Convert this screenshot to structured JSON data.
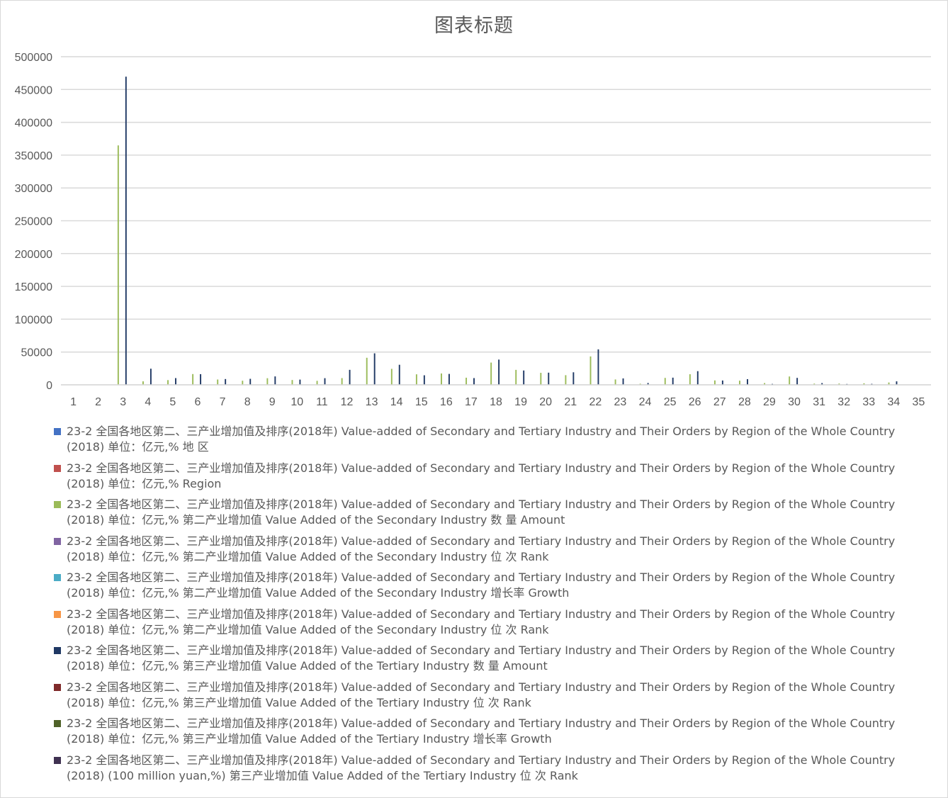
{
  "chart_data": {
    "type": "bar",
    "title": "图表标题",
    "xlabel": "",
    "ylabel": "",
    "ylim": [
      0,
      500000
    ],
    "yticks": [
      "0",
      "50000",
      "100000",
      "150000",
      "200000",
      "250000",
      "300000",
      "350000",
      "400000",
      "450000",
      "500000"
    ],
    "grid": true,
    "legend_position": "bottom",
    "categories": [
      "1",
      "2",
      "3",
      "4",
      "5",
      "6",
      "7",
      "8",
      "9",
      "10",
      "11",
      "12",
      "13",
      "14",
      "15",
      "16",
      "17",
      "18",
      "19",
      "20",
      "21",
      "22",
      "23",
      "24",
      "25",
      "26",
      "27",
      "28",
      "29",
      "30",
      "31",
      "32",
      "33",
      "34",
      "35"
    ],
    "series": [
      {
        "name": "23-2 全国各地区第二、三产业增加值及排序(2018年) Value-added of Secondary and Tertiary Industry and Their Orders by Region of the Whole Country (2018) 单位：亿元,% 地 区",
        "color": "#4472c4",
        "values": [
          0,
          0,
          0,
          0,
          0,
          0,
          0,
          0,
          0,
          0,
          0,
          0,
          0,
          0,
          0,
          0,
          0,
          0,
          0,
          0,
          0,
          0,
          0,
          0,
          0,
          0,
          0,
          0,
          0,
          0,
          0,
          0,
          0,
          0,
          0
        ]
      },
      {
        "name": "23-2 全国各地区第二、三产业增加值及排序(2018年) Value-added of Secondary and Tertiary Industry and Their Orders by Region of the Whole Country (2018) 单位：亿元,% Region",
        "color": "#c0504d",
        "values": [
          0,
          0,
          0,
          0,
          0,
          0,
          0,
          0,
          0,
          0,
          0,
          0,
          0,
          0,
          0,
          0,
          0,
          0,
          0,
          0,
          0,
          0,
          0,
          0,
          0,
          0,
          0,
          0,
          0,
          0,
          0,
          0,
          0,
          0,
          0
        ]
      },
      {
        "name": "23-2 全国各地区第二、三产业增加值及排序(2018年) Value-added of Secondary and Tertiary Industry and Their Orders by Region of the Whole Country (2018) 单位：亿元,% 第二产业增加值 Value Added of the Secondary Industry 数 量 Amount",
        "color": "#9bbb59",
        "values": [
          0,
          0,
          364835,
          5328,
          7194,
          16428,
          8108,
          6233,
          10090,
          7352,
          6086,
          10234,
          41248,
          24342,
          16018,
          17316,
          10858,
          33913,
          22817,
          18300,
          14702,
          43261,
          8185,
          1670,
          10560,
          16140,
          6710,
          6350,
          2690,
          12730,
          1850,
          1970,
          2350,
          3570,
          0
        ]
      },
      {
        "name": "23-2 全国各地区第二、三产业增加值及排序(2018年) Value-added of Secondary and Tertiary Industry and Their Orders by Region of the Whole Country (2018) 单位：亿元,% 第二产业增加值 Value Added of the Secondary Industry 位 次 Rank",
        "color": "#8064a2",
        "values": [
          0,
          0,
          0,
          28,
          21,
          9,
          19,
          22,
          17,
          20,
          23,
          16,
          2,
          5,
          10,
          8,
          15,
          3,
          6,
          7,
          13,
          1,
          18,
          30,
          14,
          11,
          24,
          25,
          29,
          12,
          31,
          30,
          28,
          27,
          0
        ]
      },
      {
        "name": "23-2 全国各地区第二、三产业增加值及排序(2018年) Value-added of Secondary and Tertiary Industry and Their Orders by Region of the Whole Country (2018) 单位：亿元,% 第二产业增加值 Value Added of the Secondary Industry 增长率 Growth",
        "color": "#4bacc6",
        "values": [
          0,
          0,
          5.8,
          4.6,
          3.7,
          5.7,
          7.2,
          4.9,
          3.4,
          4.4,
          4.9,
          3.7,
          6.0,
          5.6,
          5.5,
          6.2,
          3.9,
          6.1,
          6.4,
          5.5,
          5.2,
          4.7,
          5.3,
          6.2,
          5.4,
          8.0,
          9.3,
          7.5,
          8.3,
          6.0,
          8.6,
          6.3,
          3.5,
          4.5,
          0
        ]
      },
      {
        "name": "23-2 全国各地区第二、三产业增加值及排序(2018年) Value-added of Secondary and Tertiary Industry and Their Orders by Region of the Whole Country (2018) 单位：亿元,% 第二产业增加值 Value Added of the Secondary Industry 位 次 Rank",
        "color": "#f79646",
        "values": [
          0,
          0,
          0,
          28,
          29,
          16,
          7,
          22,
          30,
          25,
          21,
          27,
          12,
          14,
          15,
          10,
          26,
          11,
          4,
          13,
          18,
          24,
          17,
          5,
          19,
          2,
          1,
          6,
          3,
          9,
          3,
          8,
          31,
          23,
          0
        ]
      },
      {
        "name": "23-2 全国各地区第二、三产业增加值及排序(2018年) Value-added of Secondary and Tertiary Industry and Their Orders by Region of the Whole Country (2018) 单位：亿元,% 第三产业增加值 Value Added of the Tertiary Industry 数 量 Amount",
        "color": "#1f3864",
        "values": [
          0,
          0,
          469575,
          24553,
          10257,
          16278,
          8820,
          9148,
          12828,
          7968,
          10130,
          22843,
          48006,
          30568,
          14536,
          16624,
          10262,
          38470,
          21850,
          18536,
          19116,
          53989,
          9788,
          2800,
          10924,
          20840,
          6600,
          8660,
          1400,
          10570,
          2680,
          1300,
          1500,
          5310,
          0
        ]
      },
      {
        "name": "23-2 全国各地区第二、三产业增加值及排序(2018年) Value-added of Secondary and Tertiary Industry and Their Orders by Region of the Whole Country (2018) 单位：亿元,% 第三产业增加值 Value Added of the Tertiary Industry 位 次 Rank",
        "color": "#7f2a2a",
        "values": [
          0,
          0,
          0,
          5,
          17,
          14,
          22,
          20,
          16,
          23,
          19,
          6,
          2,
          4,
          15,
          13,
          18,
          3,
          7,
          12,
          11,
          1,
          21,
          29,
          16,
          8,
          24,
          22,
          31,
          18,
          28,
          31,
          30,
          26,
          0
        ]
      },
      {
        "name": "23-2 全国各地区第二、三产业增加值及排序(2018年) Value-added of Secondary and Tertiary Industry and Their Orders by Region of the Whole Country (2018) 单位：亿元,% 第三产业增加值 Value Added of the Tertiary Industry 增长率 Growth",
        "color": "#4f6228",
        "values": [
          0,
          0,
          8.0,
          7.3,
          6.6,
          7.0,
          6.0,
          6.1,
          7.0,
          5.9,
          5.3,
          8.7,
          8.4,
          9.3,
          9.3,
          9.1,
          7.3,
          8.3,
          9.6,
          9.2,
          7.8,
          7.0,
          9.6,
          7.5,
          9.8,
          9.7,
          12.3,
          9.2,
          8.0,
          9.7,
          7.0,
          8.7,
          9.1,
          7.8,
          0
        ]
      },
      {
        "name": "23-2 全国各地区第二、三产业增加值及排序(2018年) Value-added of Secondary and Tertiary Industry and Their Orders by Region of the Whole Country (2018) (100 million yuan,%) 第三产业增加值 Value Added of the Tertiary Industry 位 次 Rank",
        "color": "#3f3151",
        "values": [
          0,
          0,
          0,
          24,
          27,
          30,
          26,
          31,
          29,
          28,
          31,
          18,
          20,
          11,
          9,
          10,
          25,
          19,
          12,
          13,
          21,
          22,
          8,
          23,
          4,
          5,
          1,
          14,
          17,
          6,
          24,
          15,
          16,
          29,
          0
        ]
      }
    ]
  }
}
